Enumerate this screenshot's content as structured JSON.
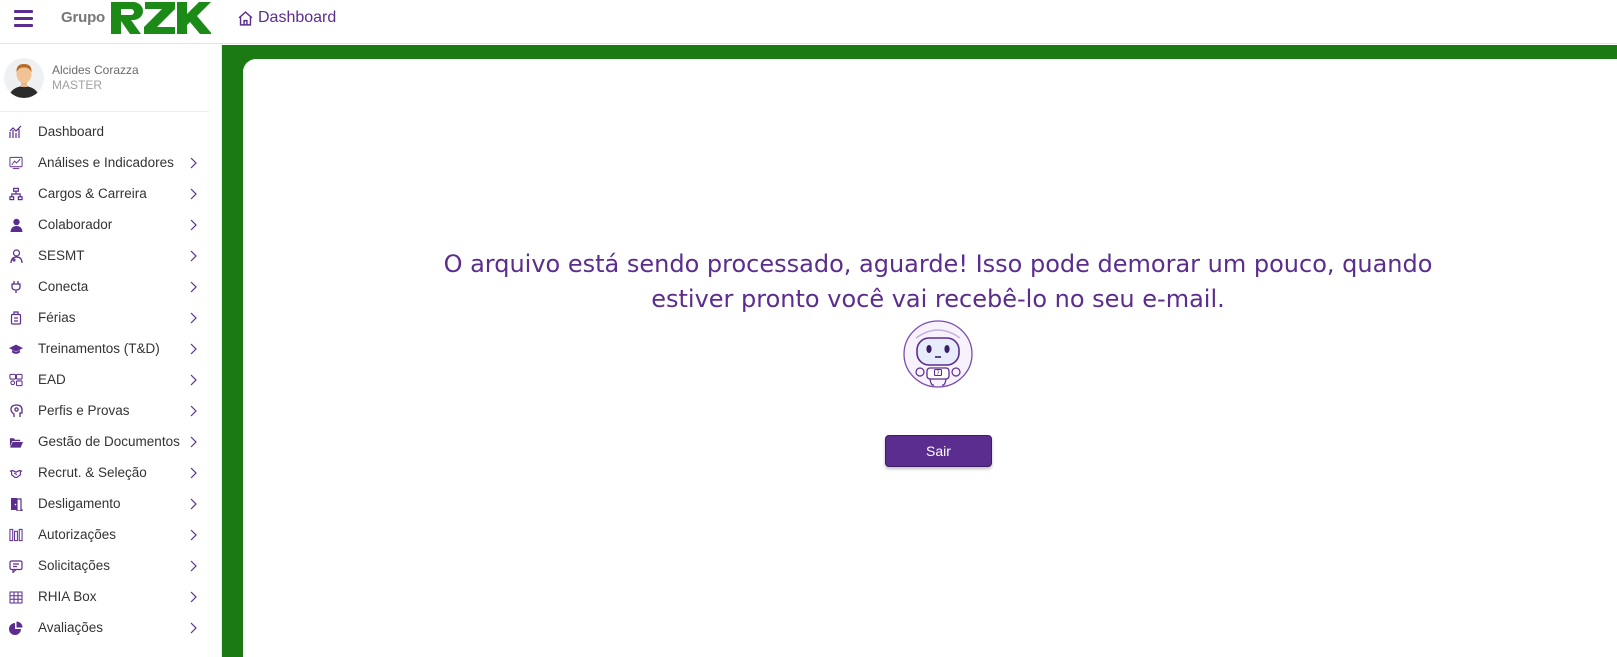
{
  "header": {
    "logo_prefix": "Grupo",
    "logo_main": "RZK",
    "breadcrumb": "Dashboard"
  },
  "user": {
    "name": "Alcides Corazza",
    "role": "MASTER"
  },
  "menu": [
    {
      "label": "Dashboard",
      "icon": "chart-icon",
      "arrow": false
    },
    {
      "label": "Análises e Indicadores",
      "icon": "analytics-icon",
      "arrow": true
    },
    {
      "label": "Cargos & Carreira",
      "icon": "org-chart-icon",
      "arrow": true
    },
    {
      "label": "Colaborador",
      "icon": "user-tie-icon",
      "arrow": true
    },
    {
      "label": "SESMT",
      "icon": "doctor-icon",
      "arrow": true
    },
    {
      "label": "Conecta",
      "icon": "plug-icon",
      "arrow": true
    },
    {
      "label": "Férias",
      "icon": "luggage-icon",
      "arrow": true
    },
    {
      "label": "Treinamentos (T&D)",
      "icon": "graduation-cap-icon",
      "arrow": true
    },
    {
      "label": "EAD",
      "icon": "classroom-icon",
      "arrow": true
    },
    {
      "label": "Perfis e Provas",
      "icon": "head-profile-icon",
      "arrow": true
    },
    {
      "label": "Gestão de Documentos",
      "icon": "folder-open-icon",
      "arrow": true
    },
    {
      "label": "Recrut. & Seleção",
      "icon": "handshake-icon",
      "arrow": true
    },
    {
      "label": "Desligamento",
      "icon": "door-exit-icon",
      "arrow": true
    },
    {
      "label": "Autorizações",
      "icon": "approval-icon",
      "arrow": true
    },
    {
      "label": "Solicitações",
      "icon": "request-chat-icon",
      "arrow": true
    },
    {
      "label": "RHIA Box",
      "icon": "grid-table-icon",
      "arrow": true
    },
    {
      "label": "Avaliações",
      "icon": "pie-chart-icon",
      "arrow": true
    }
  ],
  "main": {
    "message_line1": "O arquivo está sendo processado, aguarde! Isso pode demorar um pouco, quando",
    "message_line2": "estiver pronto você vai recebê-lo no seu e-mail.",
    "exit_button": "Sair"
  },
  "colors": {
    "brand_purple": "#5b2d8e",
    "brand_green": "#1b7a13"
  }
}
